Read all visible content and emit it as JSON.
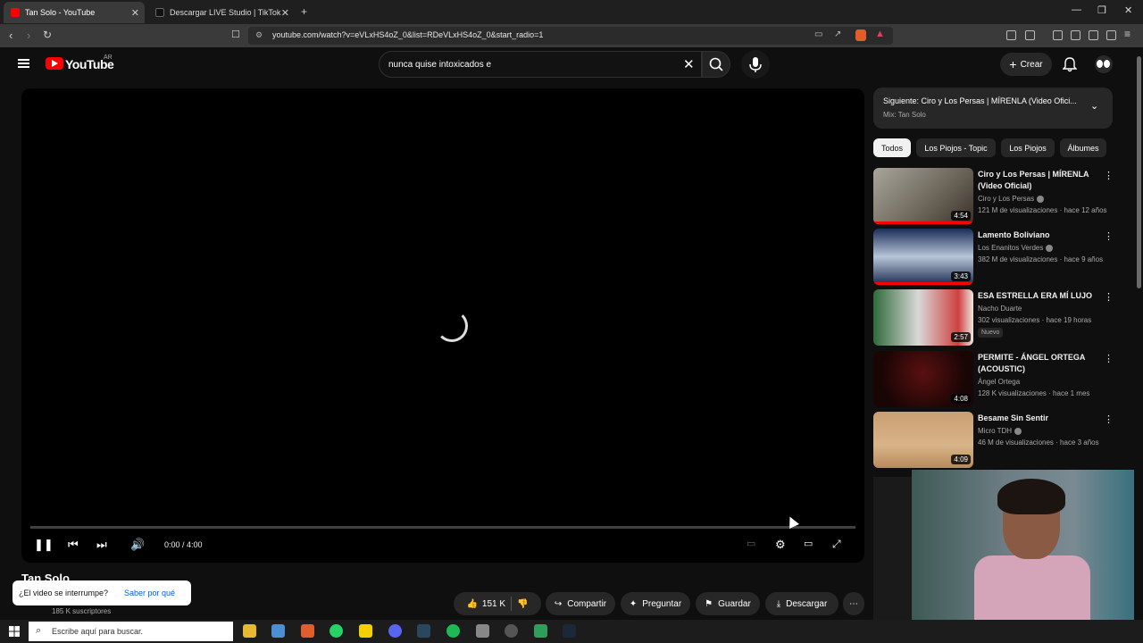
{
  "browser": {
    "tabs": [
      {
        "title": "Tan Solo - YouTube",
        "active": true
      },
      {
        "title": "Descargar LIVE Studio | TikTok",
        "active": false
      }
    ],
    "new_tab_label": "+",
    "url": "youtube.com/watch?v=eVLxHS4oZ_0&list=RDeVLxHS4oZ_0&start_radio=1"
  },
  "youtube": {
    "logo_text": "YouTube",
    "country_code": "AR",
    "search_value": "nunca quise intoxicados e",
    "create_label": "Crear"
  },
  "player": {
    "time": "0:00 / 4:00",
    "progress_fraction": 0
  },
  "video": {
    "title": "Tan Solo",
    "subscribers": "185 K suscriptores",
    "popup_question": "¿El video se interrumpe?",
    "popup_link": "Saber por qué",
    "likes": "151 K",
    "share_label": "Compartir",
    "ask_label": "Preguntar",
    "save_label": "Guardar",
    "download_label": "Descargar"
  },
  "sidebar": {
    "next_title": "Siguiente: Ciro y Los Persas | MÍRENLA (Video Ofici...",
    "next_mix": "Mix: Tan Solo",
    "chips": [
      "Todos",
      "Los Piojos - Topic",
      "Los Piojos",
      "Álbumes"
    ],
    "videos": [
      {
        "title": "Ciro y Los Persas | MÍRENLA (Video Oficial)",
        "channel": "Ciro y Los Persas",
        "verified": true,
        "meta": "121 M de visualizaciones · hace 12 años",
        "duration": "4:54",
        "badge": "",
        "watched": 1.0
      },
      {
        "title": "Lamento Boliviano",
        "channel": "Los Enanitos Verdes",
        "verified": true,
        "meta": "382 M de visualizaciones · hace 9 años",
        "duration": "3:43",
        "badge": "",
        "watched": 1.0
      },
      {
        "title": "ESA ESTRELLA ERA MÍ LUJO",
        "channel": "Nacho Duarte",
        "verified": false,
        "meta": "302 visualizaciones · hace 19 horas",
        "duration": "2:57",
        "badge": "Nuevo",
        "watched": 0.0
      },
      {
        "title": "PERMITE - ÁNGEL ORTEGA (ACOUSTIC)",
        "channel": "Ángel Ortega",
        "verified": false,
        "meta": "128 K visualizaciones · hace 1 mes",
        "duration": "4:08",
        "badge": "",
        "watched": 0.0
      },
      {
        "title": "Besame Sin Sentir",
        "channel": "Micro TDH",
        "verified": true,
        "meta": "46 M de visualizaciones · hace 3 años",
        "duration": "4:09",
        "badge": "",
        "watched": 0.0
      }
    ]
  },
  "taskbar": {
    "search_placeholder": "Escribe aquí para buscar."
  },
  "colors": {
    "accent": "#ff0000",
    "background": "#0f0f0f",
    "chip": "#272727"
  }
}
